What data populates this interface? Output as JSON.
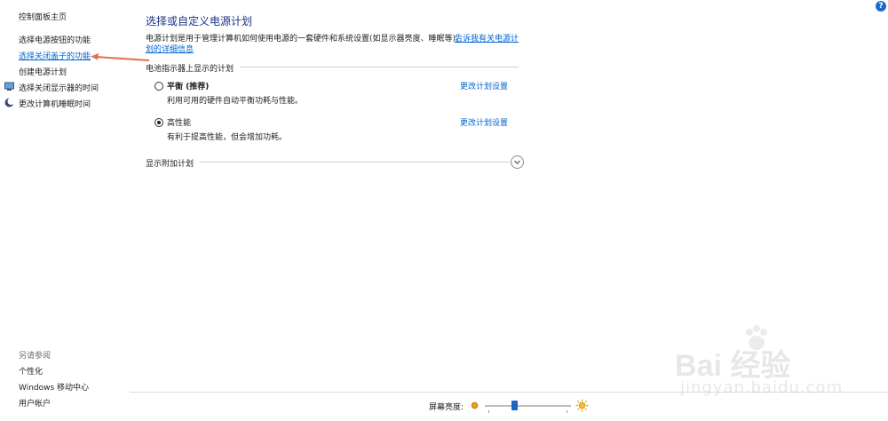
{
  "help": {
    "glyph": "?"
  },
  "sidebar": {
    "home": "控制面板主页",
    "items": [
      {
        "label": "选择电源按钮的功能"
      },
      {
        "label": "选择关闭盖子的功能",
        "active": true
      },
      {
        "label": "创建电源计划"
      },
      {
        "label": "选择关闭显示器的时间"
      },
      {
        "label": "更改计算机睡眠时间"
      }
    ],
    "see_also_title": "另请参阅",
    "see_also": [
      "个性化",
      "Windows 移动中心",
      "用户帐户"
    ]
  },
  "main": {
    "title": "选择或自定义电源计划",
    "description": "电源计划是用于管理计算机如何使用电源的一套硬件和系统设置(如显示器亮度、睡眠等)。",
    "description_link_line1": "告诉我有关电源计",
    "description_link_line2": "划的详细信息",
    "battery_section": "电池指示器上显示的计划",
    "plans": [
      {
        "name": "平衡 (推荐)",
        "desc": "利用可用的硬件自动平衡功耗与性能。",
        "selected": false,
        "change_link": "更改计划设置"
      },
      {
        "name": "高性能",
        "desc": "有利于提高性能，但会增加功耗。",
        "selected": true,
        "change_link": "更改计划设置"
      }
    ],
    "additional_section": "显示附加计划"
  },
  "footer": {
    "brightness_label": "屏幕亮度:",
    "brightness_fraction": 0.33
  },
  "watermark": {
    "text": "Bai 经验",
    "url": "jingyan.baidu.com"
  },
  "colors": {
    "link": "#0066cc",
    "title": "#1e3287",
    "arrow": "#e07050",
    "slider_thumb": "#1e64c8"
  }
}
